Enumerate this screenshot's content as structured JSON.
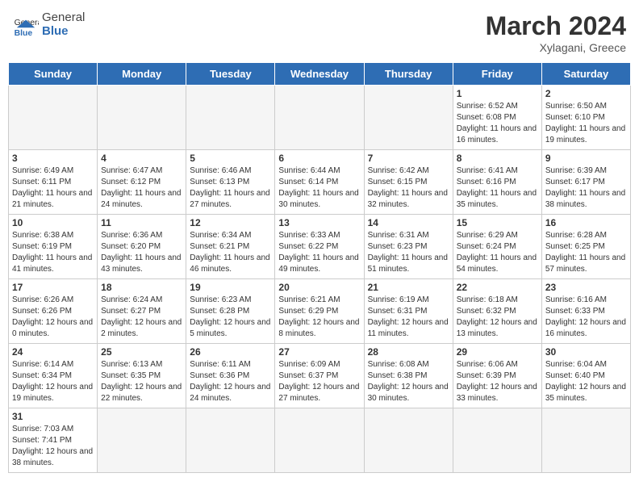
{
  "header": {
    "logo_general": "General",
    "logo_blue": "Blue",
    "title": "March 2024",
    "subtitle": "Xylagani, Greece"
  },
  "days": [
    "Sunday",
    "Monday",
    "Tuesday",
    "Wednesday",
    "Thursday",
    "Friday",
    "Saturday"
  ],
  "weeks": [
    [
      {
        "date": "",
        "info": ""
      },
      {
        "date": "",
        "info": ""
      },
      {
        "date": "",
        "info": ""
      },
      {
        "date": "",
        "info": ""
      },
      {
        "date": "",
        "info": ""
      },
      {
        "date": "1",
        "info": "Sunrise: 6:52 AM\nSunset: 6:08 PM\nDaylight: 11 hours and 16 minutes."
      },
      {
        "date": "2",
        "info": "Sunrise: 6:50 AM\nSunset: 6:10 PM\nDaylight: 11 hours and 19 minutes."
      }
    ],
    [
      {
        "date": "3",
        "info": "Sunrise: 6:49 AM\nSunset: 6:11 PM\nDaylight: 11 hours and 21 minutes."
      },
      {
        "date": "4",
        "info": "Sunrise: 6:47 AM\nSunset: 6:12 PM\nDaylight: 11 hours and 24 minutes."
      },
      {
        "date": "5",
        "info": "Sunrise: 6:46 AM\nSunset: 6:13 PM\nDaylight: 11 hours and 27 minutes."
      },
      {
        "date": "6",
        "info": "Sunrise: 6:44 AM\nSunset: 6:14 PM\nDaylight: 11 hours and 30 minutes."
      },
      {
        "date": "7",
        "info": "Sunrise: 6:42 AM\nSunset: 6:15 PM\nDaylight: 11 hours and 32 minutes."
      },
      {
        "date": "8",
        "info": "Sunrise: 6:41 AM\nSunset: 6:16 PM\nDaylight: 11 hours and 35 minutes."
      },
      {
        "date": "9",
        "info": "Sunrise: 6:39 AM\nSunset: 6:17 PM\nDaylight: 11 hours and 38 minutes."
      }
    ],
    [
      {
        "date": "10",
        "info": "Sunrise: 6:38 AM\nSunset: 6:19 PM\nDaylight: 11 hours and 41 minutes."
      },
      {
        "date": "11",
        "info": "Sunrise: 6:36 AM\nSunset: 6:20 PM\nDaylight: 11 hours and 43 minutes."
      },
      {
        "date": "12",
        "info": "Sunrise: 6:34 AM\nSunset: 6:21 PM\nDaylight: 11 hours and 46 minutes."
      },
      {
        "date": "13",
        "info": "Sunrise: 6:33 AM\nSunset: 6:22 PM\nDaylight: 11 hours and 49 minutes."
      },
      {
        "date": "14",
        "info": "Sunrise: 6:31 AM\nSunset: 6:23 PM\nDaylight: 11 hours and 51 minutes."
      },
      {
        "date": "15",
        "info": "Sunrise: 6:29 AM\nSunset: 6:24 PM\nDaylight: 11 hours and 54 minutes."
      },
      {
        "date": "16",
        "info": "Sunrise: 6:28 AM\nSunset: 6:25 PM\nDaylight: 11 hours and 57 minutes."
      }
    ],
    [
      {
        "date": "17",
        "info": "Sunrise: 6:26 AM\nSunset: 6:26 PM\nDaylight: 12 hours and 0 minutes."
      },
      {
        "date": "18",
        "info": "Sunrise: 6:24 AM\nSunset: 6:27 PM\nDaylight: 12 hours and 2 minutes."
      },
      {
        "date": "19",
        "info": "Sunrise: 6:23 AM\nSunset: 6:28 PM\nDaylight: 12 hours and 5 minutes."
      },
      {
        "date": "20",
        "info": "Sunrise: 6:21 AM\nSunset: 6:29 PM\nDaylight: 12 hours and 8 minutes."
      },
      {
        "date": "21",
        "info": "Sunrise: 6:19 AM\nSunset: 6:31 PM\nDaylight: 12 hours and 11 minutes."
      },
      {
        "date": "22",
        "info": "Sunrise: 6:18 AM\nSunset: 6:32 PM\nDaylight: 12 hours and 13 minutes."
      },
      {
        "date": "23",
        "info": "Sunrise: 6:16 AM\nSunset: 6:33 PM\nDaylight: 12 hours and 16 minutes."
      }
    ],
    [
      {
        "date": "24",
        "info": "Sunrise: 6:14 AM\nSunset: 6:34 PM\nDaylight: 12 hours and 19 minutes."
      },
      {
        "date": "25",
        "info": "Sunrise: 6:13 AM\nSunset: 6:35 PM\nDaylight: 12 hours and 22 minutes."
      },
      {
        "date": "26",
        "info": "Sunrise: 6:11 AM\nSunset: 6:36 PM\nDaylight: 12 hours and 24 minutes."
      },
      {
        "date": "27",
        "info": "Sunrise: 6:09 AM\nSunset: 6:37 PM\nDaylight: 12 hours and 27 minutes."
      },
      {
        "date": "28",
        "info": "Sunrise: 6:08 AM\nSunset: 6:38 PM\nDaylight: 12 hours and 30 minutes."
      },
      {
        "date": "29",
        "info": "Sunrise: 6:06 AM\nSunset: 6:39 PM\nDaylight: 12 hours and 33 minutes."
      },
      {
        "date": "30",
        "info": "Sunrise: 6:04 AM\nSunset: 6:40 PM\nDaylight: 12 hours and 35 minutes."
      }
    ],
    [
      {
        "date": "31",
        "info": "Sunrise: 7:03 AM\nSunset: 7:41 PM\nDaylight: 12 hours and 38 minutes."
      },
      {
        "date": "",
        "info": ""
      },
      {
        "date": "",
        "info": ""
      },
      {
        "date": "",
        "info": ""
      },
      {
        "date": "",
        "info": ""
      },
      {
        "date": "",
        "info": ""
      },
      {
        "date": "",
        "info": ""
      }
    ]
  ]
}
